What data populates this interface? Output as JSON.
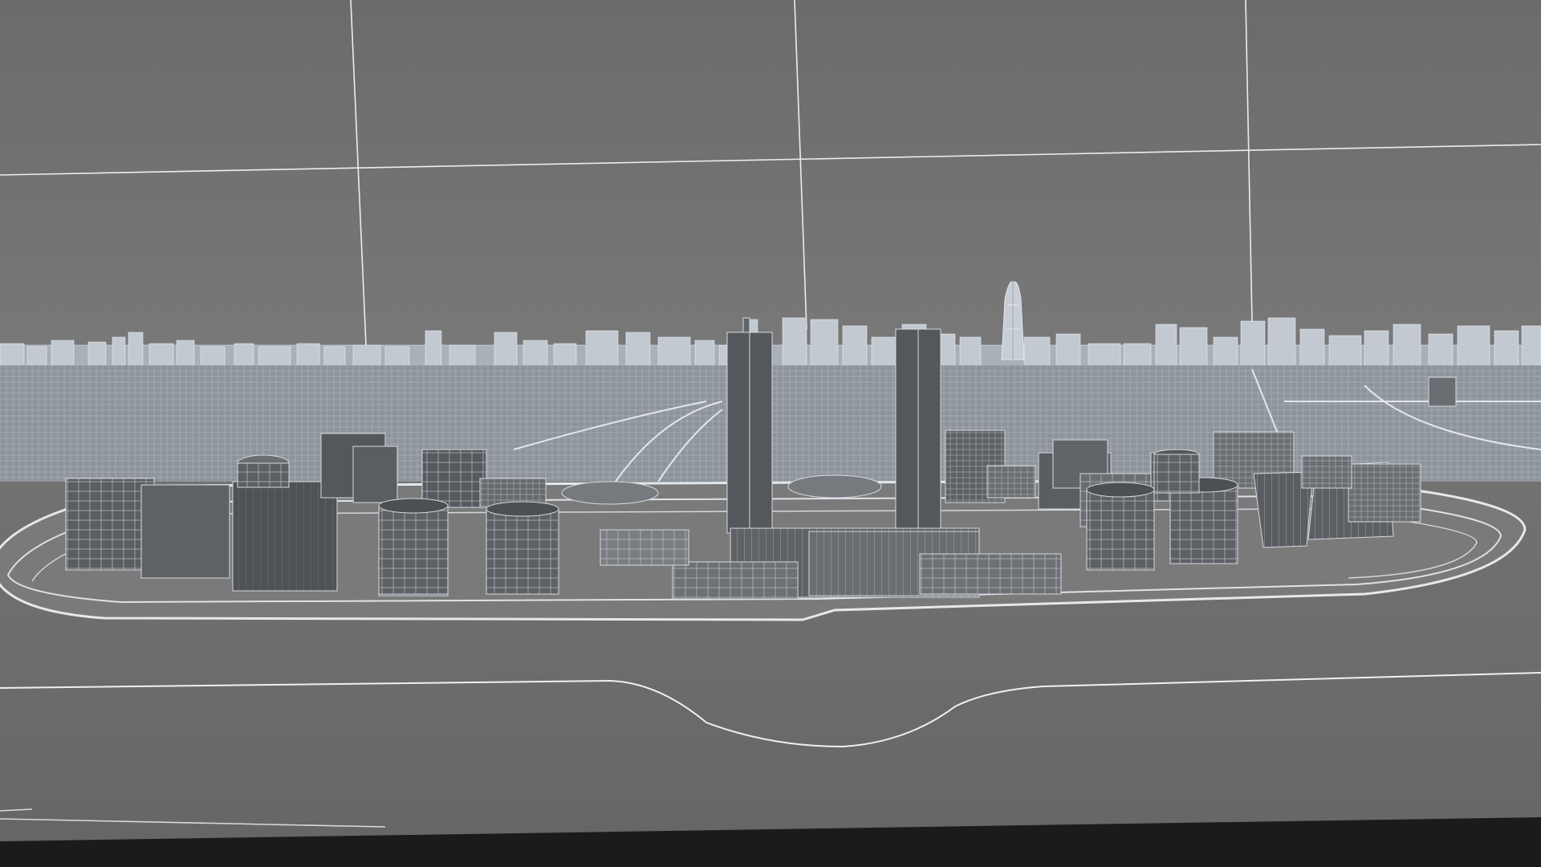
{
  "viewport": {
    "view": "perspective",
    "render_mode": "wireframe-on-shaded",
    "content": "3D city model"
  },
  "colors": {
    "sky": "#6e6e6e",
    "ground": "#6c6c6c",
    "bottom_bar": "#1b1b1b",
    "building_face": "#5c5f63",
    "building_face_dark": "#46494d",
    "wire": "#d8dde2",
    "far_city": "#b8bfc6",
    "grid_line": "#e6e6e6"
  }
}
